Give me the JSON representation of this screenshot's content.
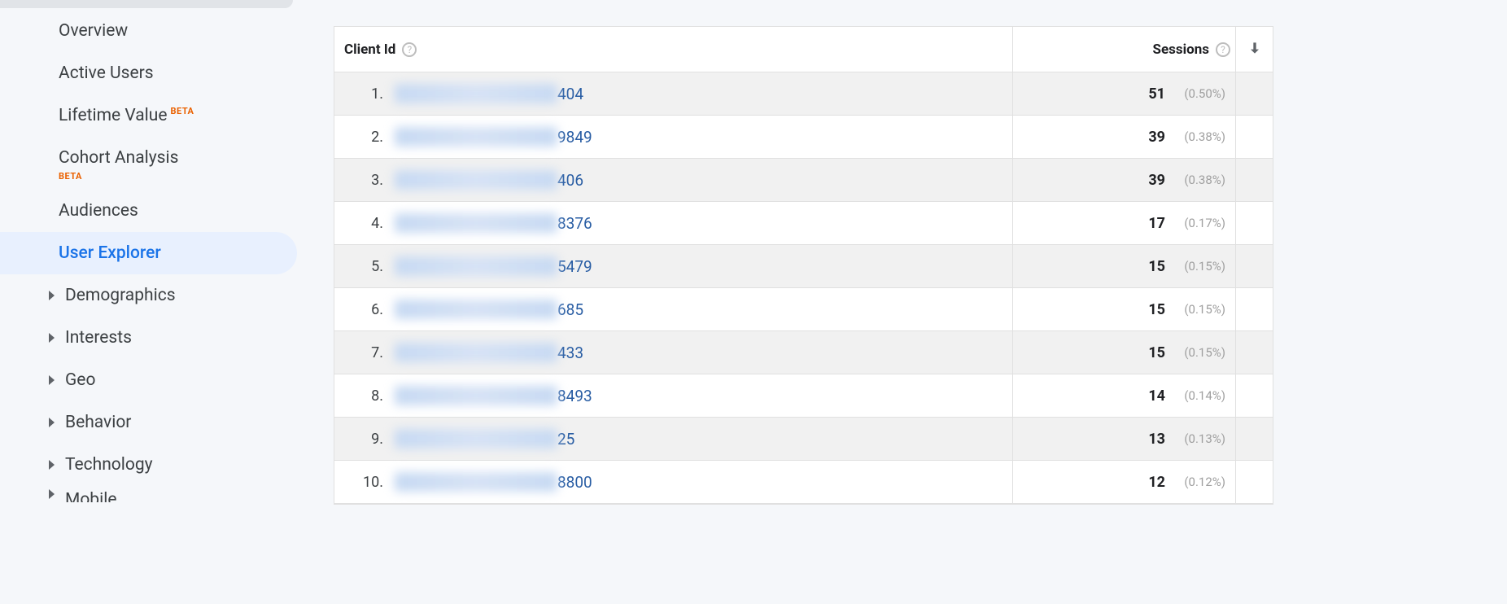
{
  "sidebar": {
    "items": [
      {
        "label": "Overview"
      },
      {
        "label": "Active Users"
      },
      {
        "label": "Lifetime Value",
        "badge": "BETA"
      },
      {
        "label": "Cohort Analysis",
        "badge": "BETA",
        "badge_below": true
      },
      {
        "label": "Audiences"
      },
      {
        "label": "User Explorer",
        "active": true
      },
      {
        "label": "Demographics",
        "caret": true
      },
      {
        "label": "Interests",
        "caret": true
      },
      {
        "label": "Geo",
        "caret": true
      },
      {
        "label": "Behavior",
        "caret": true
      },
      {
        "label": "Technology",
        "caret": true
      },
      {
        "label": "Mobile",
        "caret": true,
        "partial": true
      }
    ]
  },
  "table": {
    "header_client": "Client Id",
    "header_sessions": "Sessions",
    "help_glyph": "?",
    "rows": [
      {
        "num": "1.",
        "suffix": "404",
        "sessions": "51",
        "pct": "(0.50%)"
      },
      {
        "num": "2.",
        "suffix": "9849",
        "sessions": "39",
        "pct": "(0.38%)"
      },
      {
        "num": "3.",
        "suffix": "406",
        "sessions": "39",
        "pct": "(0.38%)"
      },
      {
        "num": "4.",
        "suffix": "8376",
        "sessions": "17",
        "pct": "(0.17%)"
      },
      {
        "num": "5.",
        "suffix": "5479",
        "sessions": "15",
        "pct": "(0.15%)"
      },
      {
        "num": "6.",
        "suffix": "685",
        "sessions": "15",
        "pct": "(0.15%)"
      },
      {
        "num": "7.",
        "suffix": "433",
        "sessions": "15",
        "pct": "(0.15%)"
      },
      {
        "num": "8.",
        "suffix": "8493",
        "sessions": "14",
        "pct": "(0.14%)"
      },
      {
        "num": "9.",
        "suffix": "25",
        "sessions": "13",
        "pct": "(0.13%)"
      },
      {
        "num": "10.",
        "suffix": "8800",
        "sessions": "12",
        "pct": "(0.12%)"
      }
    ]
  }
}
